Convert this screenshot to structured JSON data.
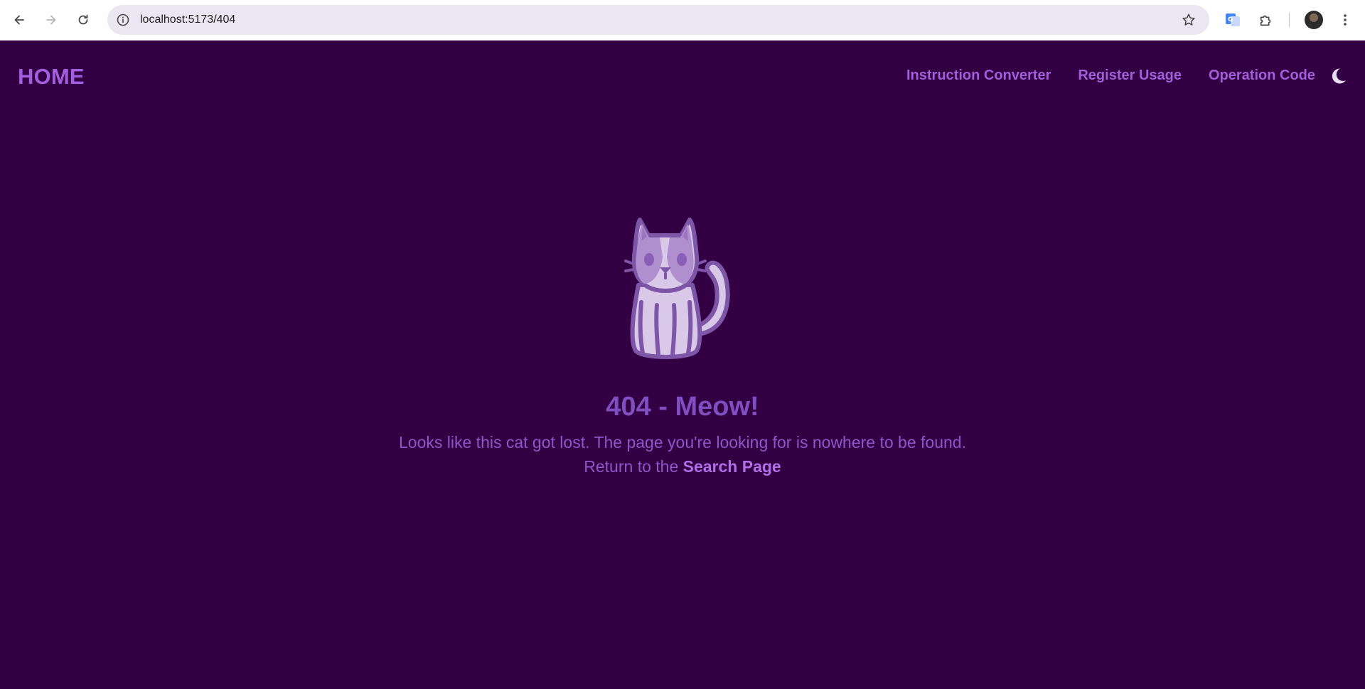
{
  "browser": {
    "url": "localhost:5173/404"
  },
  "header": {
    "home_label": "HOME",
    "nav": [
      {
        "label": "Instruction Converter"
      },
      {
        "label": "Register Usage"
      },
      {
        "label": "Operation Code"
      }
    ],
    "theme_toggle_icon": "moon-icon"
  },
  "main": {
    "illustration": "cat-icon",
    "title": "404 - Meow!",
    "message": "Looks like this cat got lost. The page you're looking for is nowhere to be found.",
    "return_prefix": "Return to the",
    "return_link": "Search Page"
  },
  "colors": {
    "background": "#330044",
    "accent": "#a35ee0",
    "title": "#7f4fc0"
  }
}
